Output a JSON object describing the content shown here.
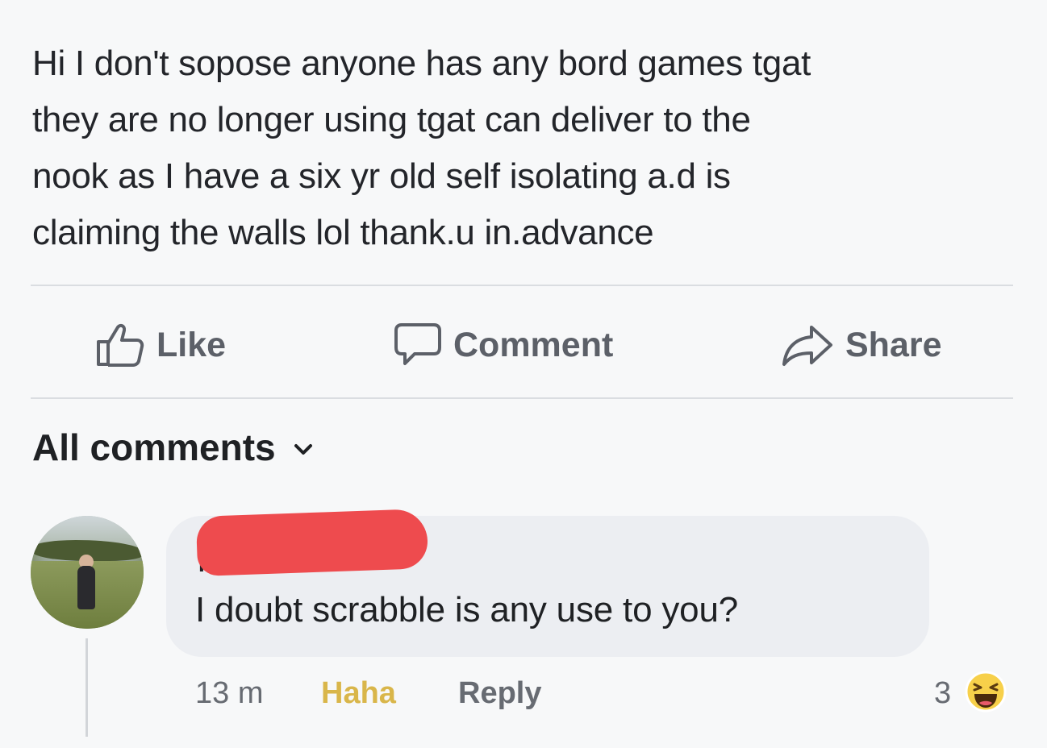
{
  "post": {
    "lines": [
      "Hi I don't sopose anyone has any bord games tgat",
      "they are no longer using tgat can deliver to the",
      "nook as I have a six yr old self isolating a.d is",
      "claiming the walls lol  thank.u in.advance"
    ]
  },
  "actions": {
    "like": "Like",
    "comment": "Comment",
    "share": "Share"
  },
  "comments_header": {
    "label": "All comments"
  },
  "comment": {
    "author_initial": "K",
    "text": "I doubt scrabble is any use to you?",
    "time": "13 m",
    "reaction_label": "Haha",
    "reply_label": "Reply",
    "reaction_count": "3"
  },
  "icons": {
    "like": "thumbs-up-icon",
    "comment": "speech-bubble-icon",
    "share": "share-arrow-icon",
    "dropdown": "chevron-down-icon",
    "reaction": "haha-emoji-icon"
  },
  "colors": {
    "haha": "#d9b64a",
    "redaction": "#ee4b4e",
    "bubble": "#eceef2"
  }
}
